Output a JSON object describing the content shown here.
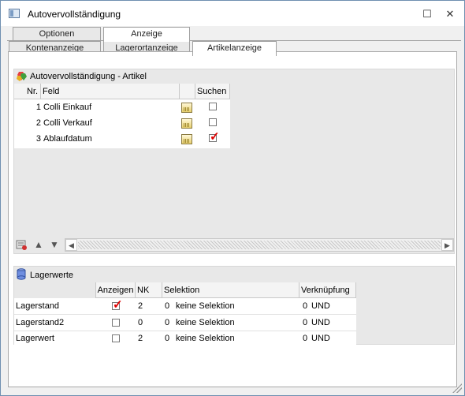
{
  "window": {
    "title": "Autovervollständigung",
    "minimize_label": "☐",
    "close_label": "✕"
  },
  "tabs_top": [
    {
      "label": "Optionen",
      "active": false
    },
    {
      "label": "Anzeige",
      "active": true
    }
  ],
  "tabs_bottom": [
    {
      "label": "Kontenanzeige",
      "active": false
    },
    {
      "label": "Lagerortanzeige",
      "active": false
    },
    {
      "label": "Artikelanzeige",
      "active": true
    }
  ],
  "autocomplete": {
    "title": "Autovervollständigung - Artikel",
    "columns": {
      "nr": "Nr.",
      "feld": "Feld",
      "suchen": "Suchen"
    },
    "rows": [
      {
        "nr": "1",
        "feld": "Colli Einkauf",
        "suchen": false
      },
      {
        "nr": "2",
        "feld": "Colli Verkauf",
        "suchen": false
      },
      {
        "nr": "3",
        "feld": "Ablaufdatum",
        "suchen": true
      }
    ]
  },
  "lager": {
    "title": "Lagerwerte",
    "columns": {
      "name": "",
      "anzeigen": "Anzeigen",
      "nk": "NK",
      "selektion": "Selektion",
      "verknuepfung": "Verknüpfung"
    },
    "rows": [
      {
        "name": "Lagerstand",
        "anzeigen": true,
        "nk": "2",
        "sel_nr": "0",
        "selektion": "keine Selektion",
        "verk_nr": "0",
        "verknuepfung": "UND"
      },
      {
        "name": "Lagerstand2",
        "anzeigen": false,
        "nk": "0",
        "sel_nr": "0",
        "selektion": "keine Selektion",
        "verk_nr": "0",
        "verknuepfung": "UND"
      },
      {
        "name": "Lagerwert",
        "anzeigen": false,
        "nk": "2",
        "sel_nr": "0",
        "selektion": "keine Selektion",
        "verk_nr": "0",
        "verknuepfung": "UND"
      }
    ]
  },
  "icons": {
    "accent_check": "#d00000"
  }
}
